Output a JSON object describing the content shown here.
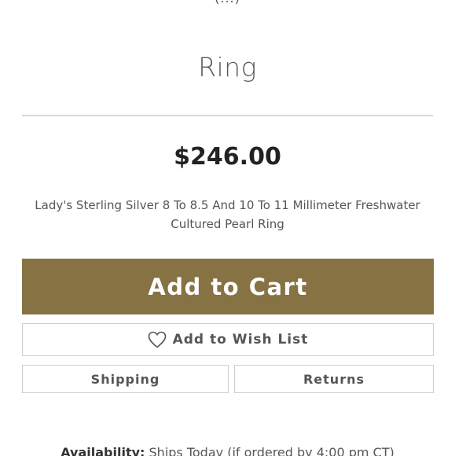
{
  "header": {
    "cut_text": "(...)"
  },
  "product": {
    "title": "Ring",
    "price": "$246.00",
    "description": "Lady's Sterling Silver 8 To 8.5 And 10 To 11 Millimeter Freshwater Cultured Pearl Ring"
  },
  "actions": {
    "add_to_cart": "Add to Cart",
    "wish_list": "Add to Wish List",
    "shipping": "Shipping",
    "returns": "Returns"
  },
  "availability": {
    "label": "Availability:",
    "value": "Ships Today (if ordered by 4:00 pm CT)"
  },
  "colors": {
    "cart_button": "#877244",
    "divider": "#d8d8d8",
    "border": "#cfcfcf"
  },
  "icons": {
    "wish": "heart-icon"
  }
}
